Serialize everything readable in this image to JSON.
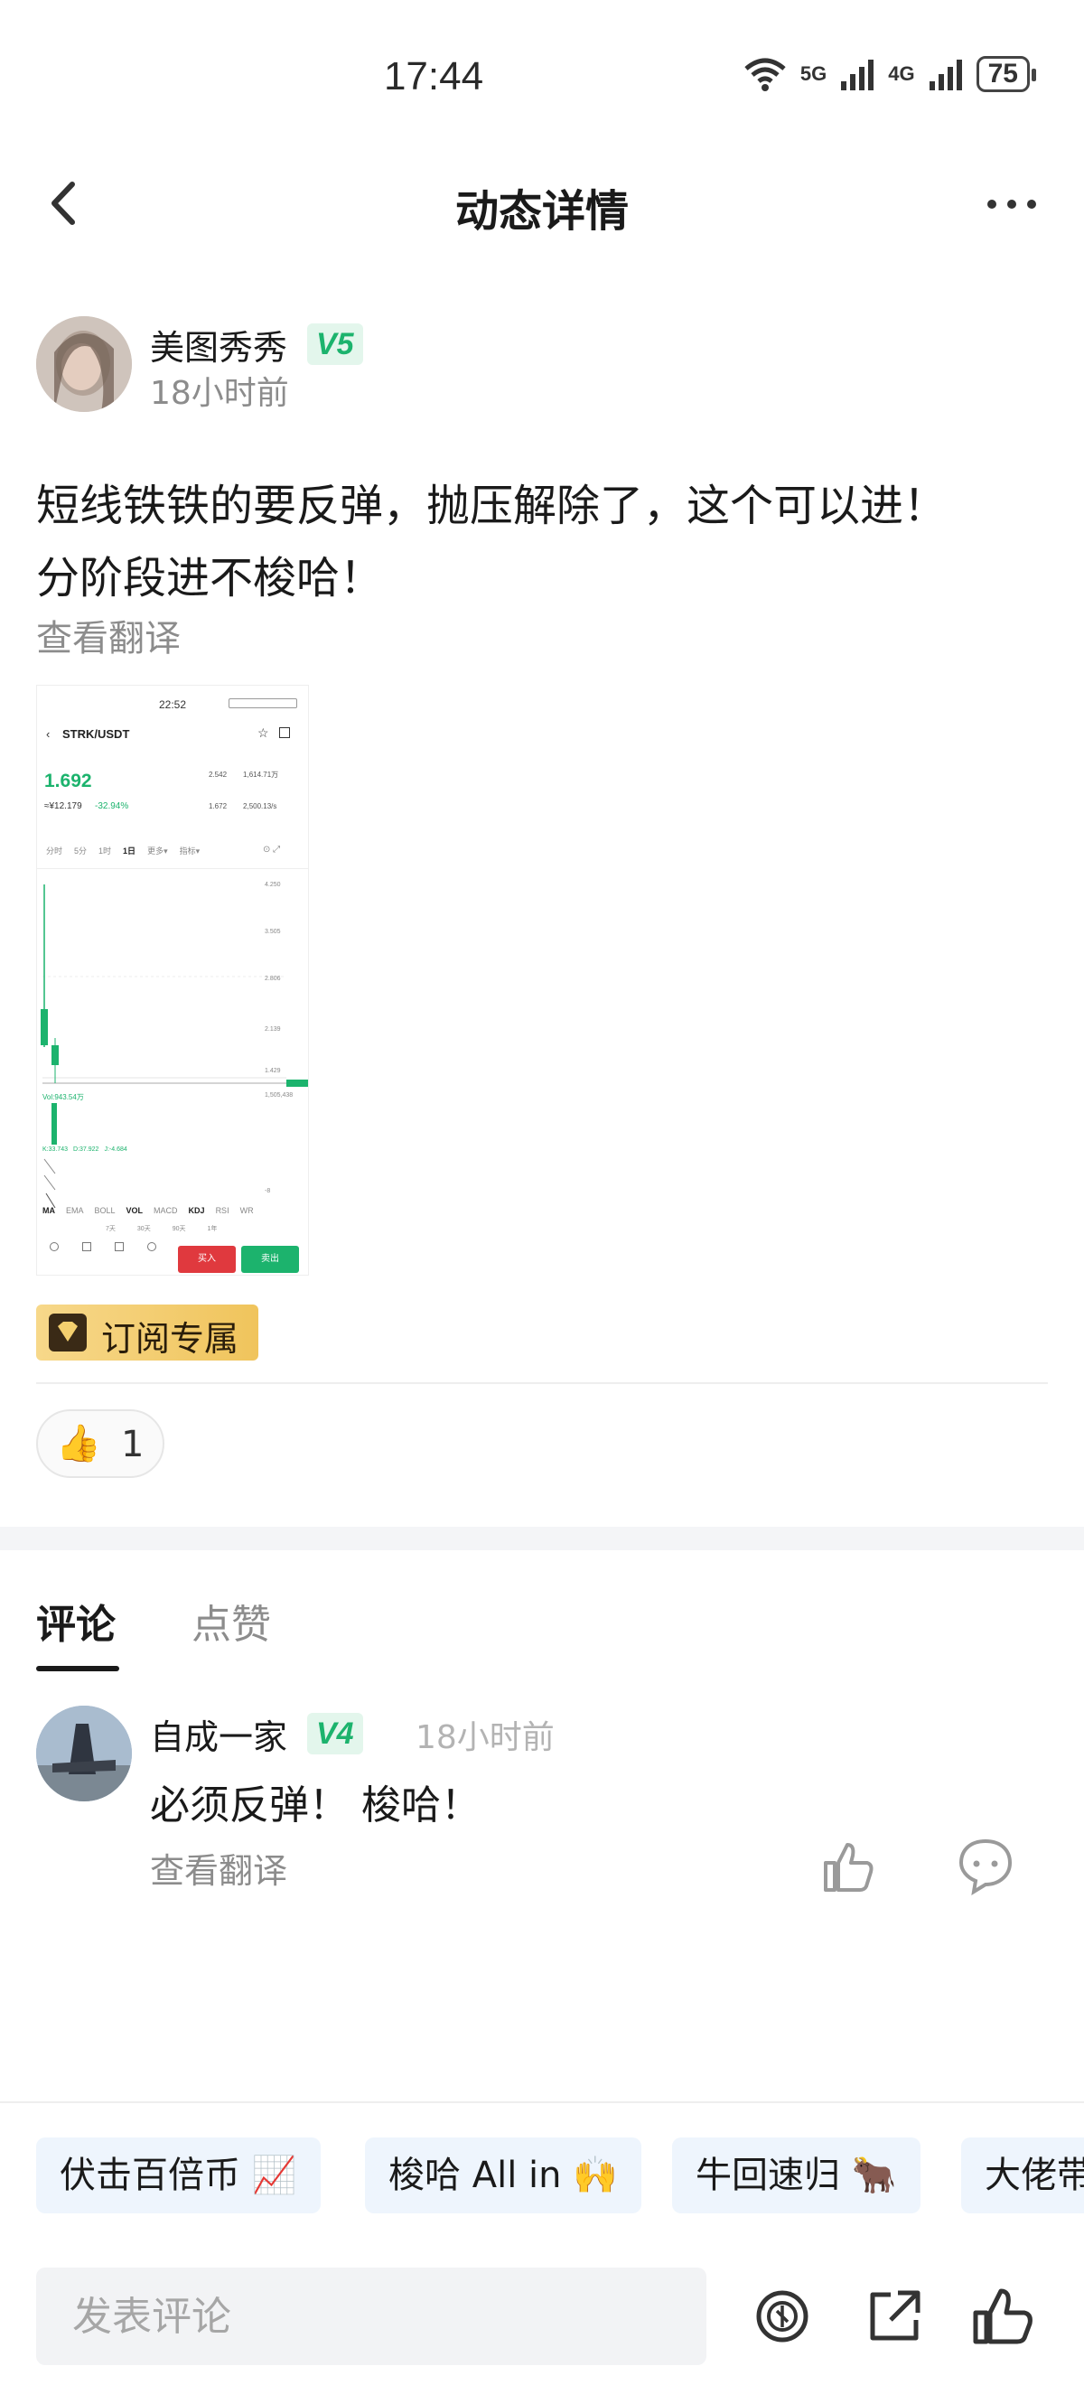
{
  "status_bar": {
    "time": "17:44",
    "net1": "5G",
    "net2": "4G",
    "battery": "75"
  },
  "nav": {
    "title": "动态详情"
  },
  "post": {
    "author": {
      "name": "美图秀秀",
      "level": "V5",
      "time": "18小时前"
    },
    "text_line1": "短线铁铁的要反弹，抛压解除了，这个可以进！",
    "text_line2": "分阶段进不梭哈！",
    "translate_label": "查看翻译",
    "subscription_label": "订阅专属",
    "like_count": "1"
  },
  "screenshot": {
    "time": "22:52",
    "pair": "STRK/USDT",
    "price": "1.692",
    "cny_price": "≈¥12.179",
    "change": "-32.94%",
    "stats": [
      "2.542",
      "1,614.71万",
      "1.672",
      "2,500.13/s"
    ],
    "ranges": [
      "分时",
      "5分",
      "1时",
      "1日",
      "更多▾",
      "指标▾"
    ],
    "axis_values": [
      "4.250",
      "3.505",
      "2.806",
      "2.139",
      "1.429"
    ],
    "vol_label": "Vol:943.54万",
    "vol_axis": [
      "1,505,438"
    ],
    "kdj_values": [
      "K:33.743",
      "D:37.922",
      "J:-4.684"
    ],
    "kdj_axis": [
      "-8"
    ],
    "indicators": [
      "MA",
      "EMA",
      "BOLL",
      "VOL",
      "MACD",
      "KDJ",
      "RSI",
      "WR"
    ],
    "periods": [
      "7天",
      "30天",
      "90天",
      "1年"
    ],
    "buy_label": "买入",
    "sell_label": "卖出",
    "colors": {
      "up": "#1cb36d",
      "down": "#e0393e"
    }
  },
  "tabs": {
    "comments": "评论",
    "likes": "点赞"
  },
  "comment": {
    "author": "自成一家",
    "level": "V4",
    "time": "18小时前",
    "text": "必须反弹！ 梭哈！",
    "translate_label": "查看翻译"
  },
  "quick_replies": [
    "伏击百倍币 📈",
    "梭哈 All in 🙌",
    "牛回速归 🐂",
    "大佬带"
  ],
  "input": {
    "placeholder": "发表评论"
  },
  "icons": {
    "back": "back-arrow-icon",
    "more": "more-dots-icon",
    "thumb_emoji": "👍",
    "comment_like": "thumbs-up-icon",
    "comment_reply": "chat-bubble-icon",
    "tip": "coin-icon",
    "share": "share-icon",
    "like": "thumbs-up-icon"
  }
}
